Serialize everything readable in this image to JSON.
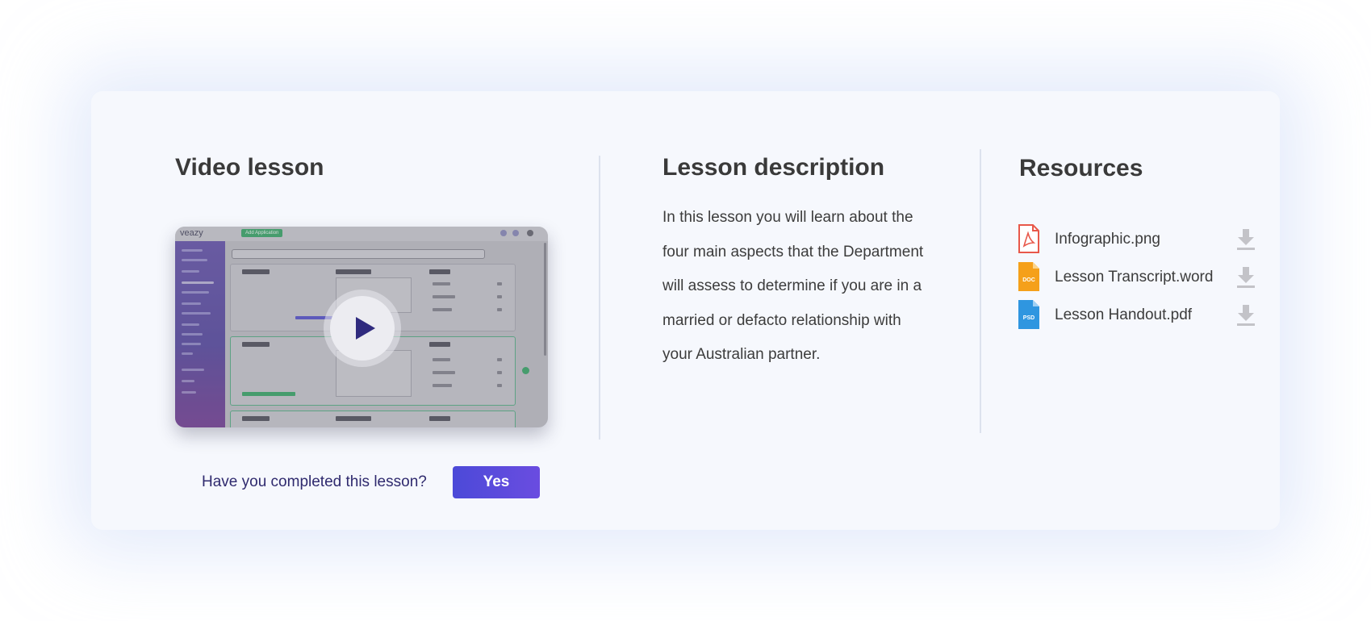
{
  "video_lesson": {
    "title": "Video lesson",
    "thumbnail": {
      "app_logo": "veazy",
      "add_button": "Add Application"
    },
    "play_icon": "play-icon",
    "question": "Have you completed this lesson?",
    "yes_label": "Yes"
  },
  "lesson_description": {
    "title": "Lesson description",
    "text": "In this lesson you will learn about the four main aspects that the Department will assess to determine if you are in a married or defacto relationship with your Australian partner."
  },
  "resources": {
    "title": "Resources",
    "items": [
      {
        "name": "Infographic.png",
        "icon": "pdf-file-icon",
        "badge": "",
        "color": "#e8584a"
      },
      {
        "name": "Lesson Transcript.word",
        "icon": "doc-file-icon",
        "badge": "DOC",
        "color": "#f5a01a"
      },
      {
        "name": "Lesson Handout.pdf",
        "icon": "psd-file-icon",
        "badge": "PSD",
        "color": "#2f96e0"
      }
    ],
    "download_icon": "download-icon"
  },
  "colors": {
    "accent": "#5a4be0",
    "question_text": "#2f2a6e",
    "card_background": "#f6f8fd"
  }
}
